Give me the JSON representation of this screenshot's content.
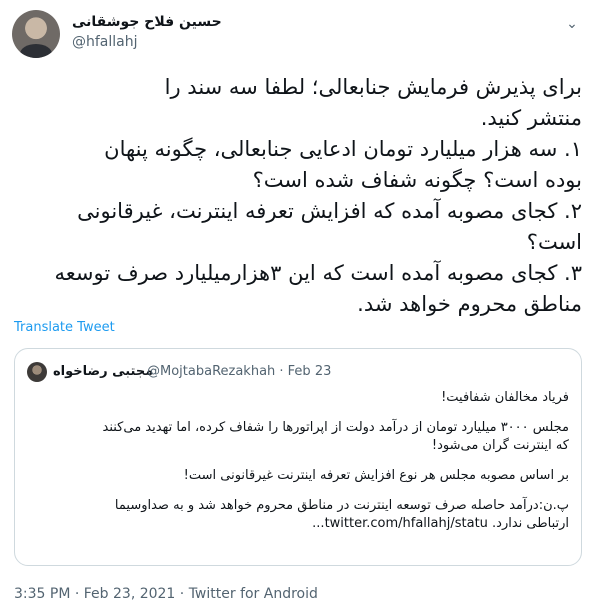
{
  "author": {
    "name": "حسین فلاح جوشقانی",
    "handle": "@hfallahj"
  },
  "tweet": {
    "lines": [
      "برای پذیرش فرمایش جنابعالی؛ لطفا سه سند را",
      "منتشر کنید.",
      "۱. سه هزار میلیارد تومان ادعایی جنابعالی، چگونه پنهان",
      "بوده است؟ چگونه شفاف شده است؟",
      "۲. کجای مصوبه آمده که افزایش تعرفه اینترنت، غیرقانونی",
      "است؟",
      "۳. کجای مصوبه آمده است که این ۳هزارمیلیارد صرف توسعه",
      "مناطق محروم خواهد شد."
    ]
  },
  "translate_label": "Translate Tweet",
  "quoted": {
    "name": "مجتبی رضاخواه",
    "meta": "@MojtabaRezakhah · Feb 23",
    "lines": [
      "فریاد مخالفان شفافیت!",
      "",
      "مجلس ۳۰۰۰ میلیارد تومان از درآمد دولت از اپراتورها را شفاف کرده، اما تهدید می‌کنند",
      "که اینترنت گران می‌شود!",
      "",
      "بر اساس مصوبه مجلس هر نوع افزایش تعرفه اینترنت غیرقانونی است!",
      "",
      "پ.ن:درآمد حاصله صرف توسعه اینترنت در مناطق محروم خواهد شد و به صداوسیما",
      "ارتباطی ندارد. twitter.com/hfallahj/statu..."
    ]
  },
  "footer": "3:35 PM · Feb 23, 2021 · Twitter for Android",
  "colors": {
    "link": "#1d9bf0",
    "muted": "#536471",
    "border": "#cfd9de"
  }
}
